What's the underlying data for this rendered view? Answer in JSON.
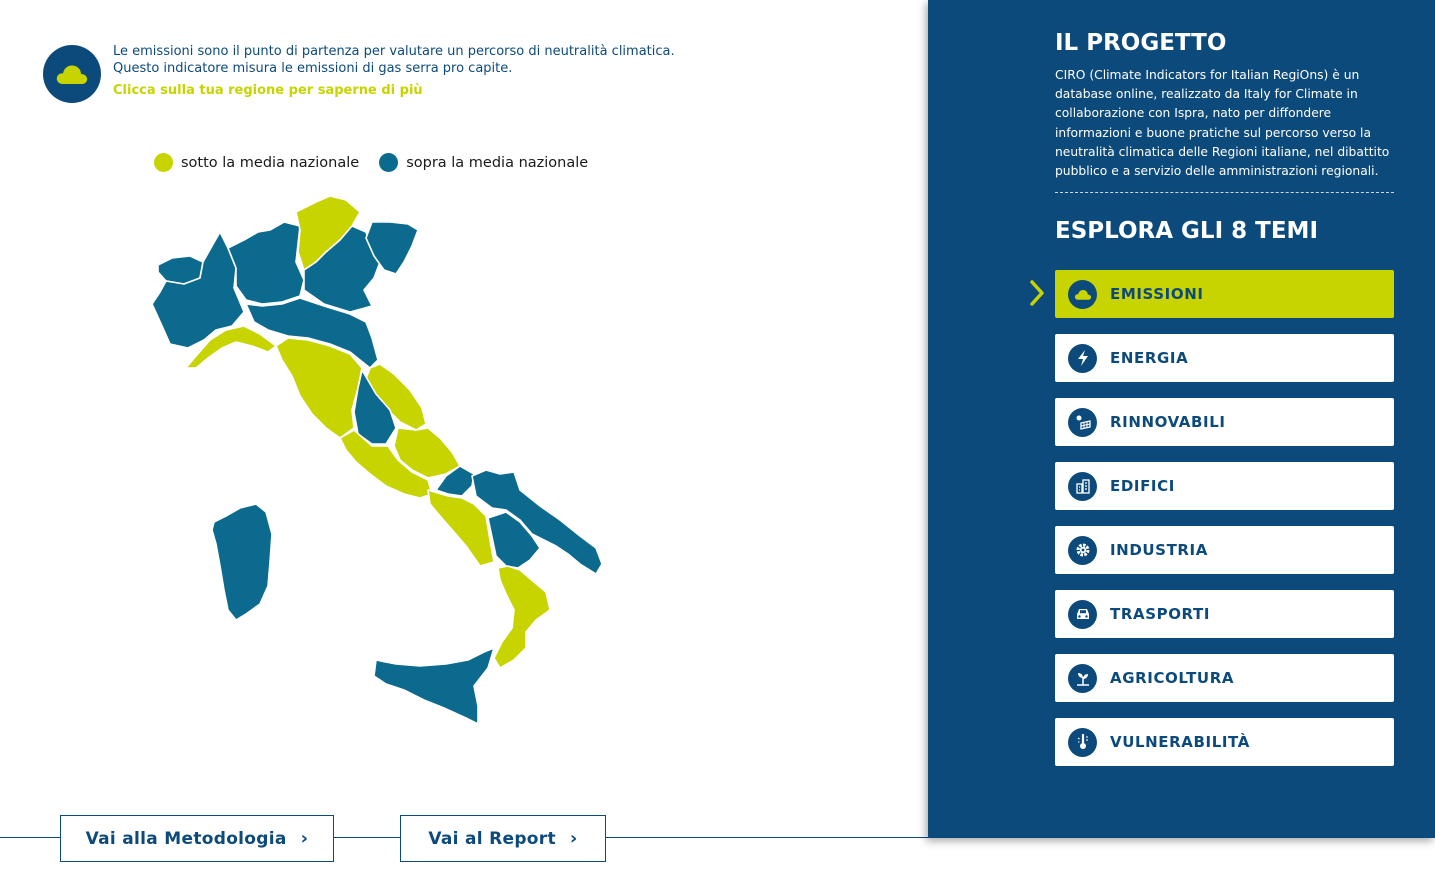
{
  "intro": {
    "line1": "Le emissioni sono il punto di partenza per valutare un percorso di neutralità climatica.",
    "line2": "Questo indicatore misura le emissioni di gas serra pro capite.",
    "cta": "Clicca sulla tua regione per saperne di più"
  },
  "legend": {
    "below": {
      "label": "sotto la media nazionale",
      "color": "#c8d400"
    },
    "above": {
      "label": "sopra la media nazionale",
      "color": "#0b6a8e"
    }
  },
  "map": {
    "regions": [
      {
        "id": "trentino",
        "status": "below"
      },
      {
        "id": "piemonte",
        "status": "above"
      },
      {
        "id": "valle-aosta",
        "status": "above"
      },
      {
        "id": "lombardia",
        "status": "above"
      },
      {
        "id": "veneto",
        "status": "above"
      },
      {
        "id": "friuli",
        "status": "above"
      },
      {
        "id": "liguria",
        "status": "below"
      },
      {
        "id": "emilia-romagna",
        "status": "above"
      },
      {
        "id": "toscana",
        "status": "below"
      },
      {
        "id": "umbria",
        "status": "above"
      },
      {
        "id": "marche",
        "status": "below"
      },
      {
        "id": "lazio",
        "status": "below"
      },
      {
        "id": "abruzzo",
        "status": "below"
      },
      {
        "id": "molise",
        "status": "above"
      },
      {
        "id": "campania",
        "status": "below"
      },
      {
        "id": "puglia",
        "status": "above"
      },
      {
        "id": "basilicata",
        "status": "above"
      },
      {
        "id": "calabria",
        "status": "below"
      },
      {
        "id": "sicilia",
        "status": "above"
      },
      {
        "id": "sardegna",
        "status": "above"
      }
    ]
  },
  "buttons": {
    "methodology": "Vai alla Metodologia",
    "report": "Vai al Report",
    "chevron": "›"
  },
  "panel": {
    "project_title": "IL PROGETTO",
    "project_lines": [
      "CIRO (Climate Indicators for Italian RegiOns) è un",
      "database online, realizzato da Italy for Climate in",
      "collaborazione con Ispra, nato per diffondere",
      "informazioni e buone pratiche sul percorso verso la",
      "neutralità climatica delle Regioni italiane, nel dibattito",
      "pubblico e a servizio delle amministrazioni regionali."
    ],
    "themes_title": "ESPLORA GLI 8 TEMI",
    "themes": [
      {
        "label": "EMISSIONI",
        "icon": "cloud-icon",
        "active": true
      },
      {
        "label": "ENERGIA",
        "icon": "lightning-icon",
        "active": false
      },
      {
        "label": "RINNOVABILI",
        "icon": "solar-panel-icon",
        "active": false
      },
      {
        "label": "EDIFICI",
        "icon": "building-icon",
        "active": false
      },
      {
        "label": "INDUSTRIA",
        "icon": "gear-icon",
        "active": false
      },
      {
        "label": "TRASPORTI",
        "icon": "car-icon",
        "active": false
      },
      {
        "label": "AGRICOLTURA",
        "icon": "plant-icon",
        "active": false
      },
      {
        "label": "VULNERABILITÀ",
        "icon": "thermometer-icon",
        "active": false
      }
    ]
  },
  "colors": {
    "brand_blue": "#0d4a7c",
    "accent_lime": "#c8d400",
    "region_blue": "#0b6a8e"
  }
}
